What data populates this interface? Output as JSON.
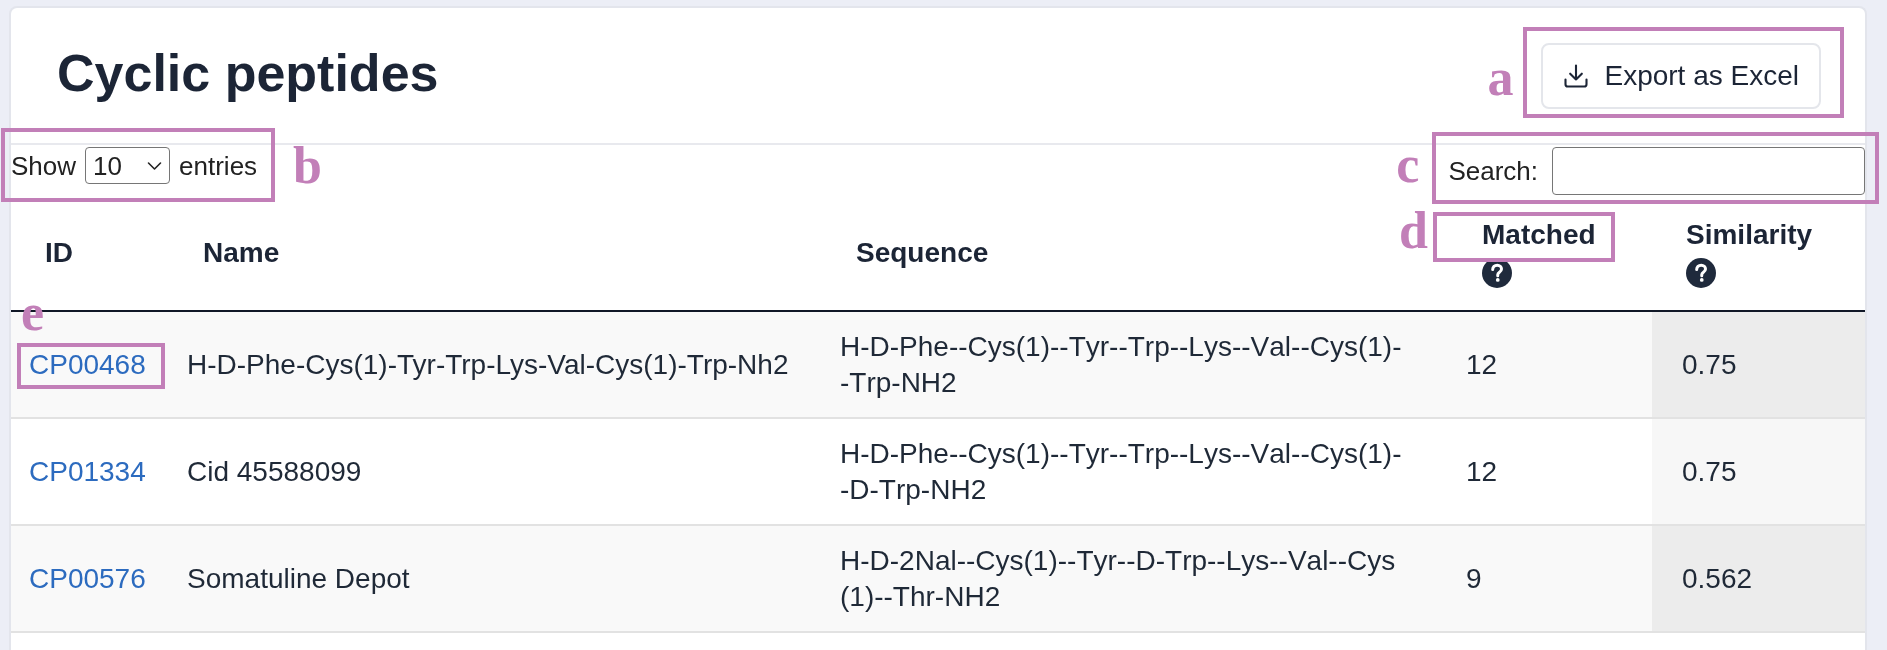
{
  "page": {
    "title": "Cyclic peptides"
  },
  "export_button": {
    "label": "Export as Excel",
    "callout": "a"
  },
  "length_control": {
    "prefix": "Show",
    "value": "10",
    "suffix": "entries",
    "callout": "b"
  },
  "search": {
    "label": "Search:",
    "callout": "c"
  },
  "table": {
    "columns": [
      {
        "label": "ID",
        "help": false,
        "sorted": false
      },
      {
        "label": "Name",
        "help": false,
        "sorted": false
      },
      {
        "label": "Sequence",
        "help": false,
        "sorted": false
      },
      {
        "label": "Matched",
        "help": true,
        "sorted": false,
        "callout": "d"
      },
      {
        "label": "Similarity",
        "help": true,
        "sorted": true
      }
    ],
    "rows": [
      {
        "id": "CP00468",
        "id_callout": "e",
        "name": "H-D-Phe-Cys(1)-Tyr-Trp-Lys-Val-Cys(1)-Trp-Nh2",
        "sequence": "H-D-Phe--Cys(1)--Tyr--Trp--Lys--Val--Cys(1)--Trp-NH2",
        "matched": "12",
        "similarity": "0.75"
      },
      {
        "id": "CP01334",
        "name": "Cid 45588099",
        "sequence": "H-D-Phe--Cys(1)--Tyr--Trp--Lys--Val--Cys(1)--D-Trp-NH2",
        "matched": "12",
        "similarity": "0.75"
      },
      {
        "id": "CP00576",
        "name": "Somatuline Depot",
        "sequence": "H-D-2Nal--Cys(1)--Tyr--D-Trp--Lys--Val--Cys(1)--Thr-NH2",
        "matched": "9",
        "similarity": "0.562"
      }
    ]
  }
}
